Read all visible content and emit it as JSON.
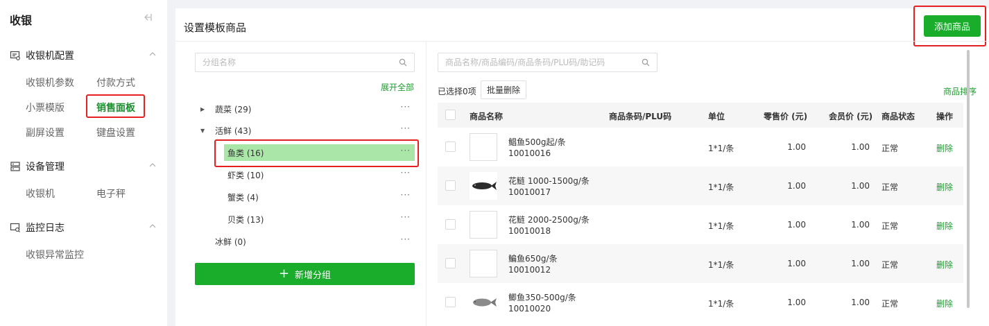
{
  "sidebar": {
    "title": "收银",
    "sections": [
      {
        "label": "收银机配置",
        "items": [
          "收银机参数",
          "付款方式",
          "小票模版",
          "销售面板",
          "副屏设置",
          "键盘设置"
        ]
      },
      {
        "label": "设备管理",
        "items": [
          "收银机",
          "电子秤"
        ]
      },
      {
        "label": "监控日志",
        "items": [
          "收银异常监控"
        ]
      }
    ],
    "active_item": "销售面板"
  },
  "main": {
    "title": "设置模板商品",
    "add_button": "添加商品"
  },
  "tree": {
    "search_placeholder": "分组名称",
    "expand_all": "展开全部",
    "nodes": [
      {
        "label": "蔬菜 (29)",
        "expanded": false
      },
      {
        "label": "活鲜 (43)",
        "expanded": true
      },
      {
        "label": "鱼类 (16)",
        "selected": true
      },
      {
        "label": "虾类 (10)"
      },
      {
        "label": "蟹类 (4)"
      },
      {
        "label": "贝类 (13)"
      },
      {
        "label": "冰鲜 (0)"
      }
    ],
    "more_glyph": "···",
    "new_group_button": "新增分组"
  },
  "products": {
    "search_placeholder": "商品名称/商品编码/商品条码/PLU码/助记码",
    "selected_count": "已选择0项",
    "batch_delete": "批量删除",
    "sort_link": "商品排序",
    "columns": [
      "商品名称",
      "商品条码/PLU码",
      "单位",
      "零售价 (元)",
      "会员价 (元)",
      "商品状态",
      "操作"
    ],
    "rows": [
      {
        "name": "鲳鱼500g起/条",
        "code": "10010016",
        "unit": "1*1/条",
        "retail": "1.00",
        "member": "1.00",
        "status": "正常",
        "action": "删除",
        "image": "none"
      },
      {
        "name": "花鲢 1000-1500g/条",
        "code": "10010017",
        "unit": "1*1/条",
        "retail": "1.00",
        "member": "1.00",
        "status": "正常",
        "action": "删除",
        "image": "dark-fish"
      },
      {
        "name": "花鲢 2000-2500g/条",
        "code": "10010018",
        "unit": "1*1/条",
        "retail": "1.00",
        "member": "1.00",
        "status": "正常",
        "action": "删除",
        "image": "none"
      },
      {
        "name": "鳊鱼650g/条",
        "code": "10010012",
        "unit": "1*1/条",
        "retail": "1.00",
        "member": "1.00",
        "status": "正常",
        "action": "删除",
        "image": "none"
      },
      {
        "name": "鲫鱼350-500g/条",
        "code": "10010020",
        "unit": "1*1/条",
        "retail": "1.00",
        "member": "1.00",
        "status": "正常",
        "action": "删除",
        "image": "grey-fish"
      }
    ]
  },
  "colors": {
    "accent": "#1aad2c",
    "highlight": "#abe6a9",
    "annotation": "#e62020"
  }
}
